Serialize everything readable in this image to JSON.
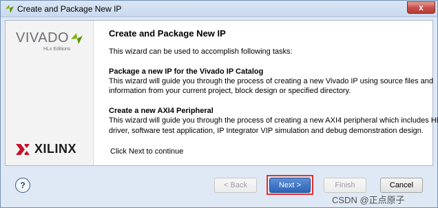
{
  "window": {
    "title": "Create and Package New IP",
    "close_label": "x"
  },
  "branding": {
    "vivado_word": "VIVADO",
    "vivado_edition": "HLx Editions",
    "xilinx_word": "XILINX"
  },
  "content": {
    "heading": "Create and Package New IP",
    "intro": "This wizard can be used to accomplish following tasks:",
    "section1_title": "Package a new IP for the Vivado IP Catalog",
    "section1_line1": "This wizard will guide you through the process of creating a new Vivado IP using source files and",
    "section1_line2": "information from your current project, block design or specified directory.",
    "section2_title": "Create a new AXI4 Peripheral",
    "section2_line1": "This wizard will guide you through the process of creating a new AXI4 peripheral which includes HDL,",
    "section2_line2": "driver, software test application, IP Integrator VIP simulation and debug demonstration design.",
    "footer": "Click Next to continue"
  },
  "buttons": {
    "help": "?",
    "back": "< Back",
    "next": "Next >",
    "finish": "Finish",
    "cancel": "Cancel"
  },
  "watermark": "CSDN @正点原子",
  "colors": {
    "accent": "#2f65b7",
    "highlight": "#e03030",
    "vivado_leaf": "#7ab800"
  }
}
